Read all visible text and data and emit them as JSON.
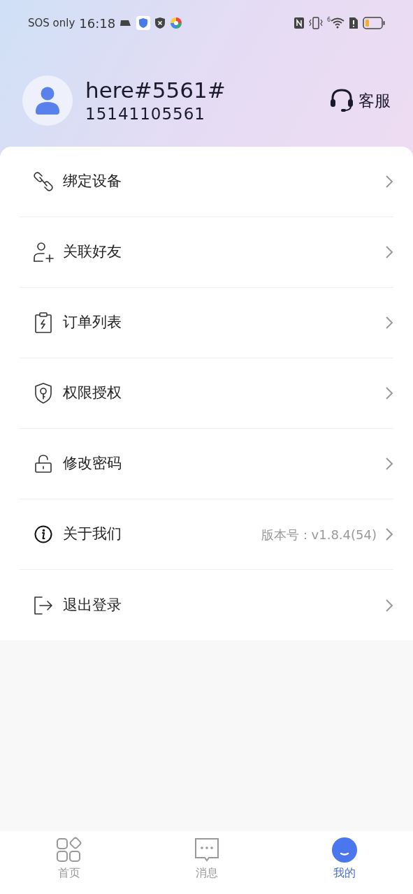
{
  "status_bar": {
    "carrier": "SOS only",
    "time": "16:18",
    "wifi_badge": "6"
  },
  "profile": {
    "name": "here#5561#",
    "phone": "15141105561",
    "support": "客服"
  },
  "menu": [
    {
      "kind": "link",
      "label": "绑定设备"
    },
    {
      "kind": "user-add",
      "label": "关联好友"
    },
    {
      "kind": "clipboard",
      "label": "订单列表"
    },
    {
      "kind": "shield",
      "label": "权限授权"
    },
    {
      "kind": "lock",
      "label": "修改密码"
    },
    {
      "kind": "info",
      "label": "关于我们",
      "value": "版本号：v1.8.4(54)"
    },
    {
      "kind": "logout",
      "label": "退出登录"
    }
  ],
  "tabs": [
    {
      "kind": "home",
      "label": "首页",
      "selected": false
    },
    {
      "kind": "message",
      "label": "消息",
      "selected": false
    },
    {
      "kind": "me",
      "label": "我的",
      "selected": true
    }
  ]
}
